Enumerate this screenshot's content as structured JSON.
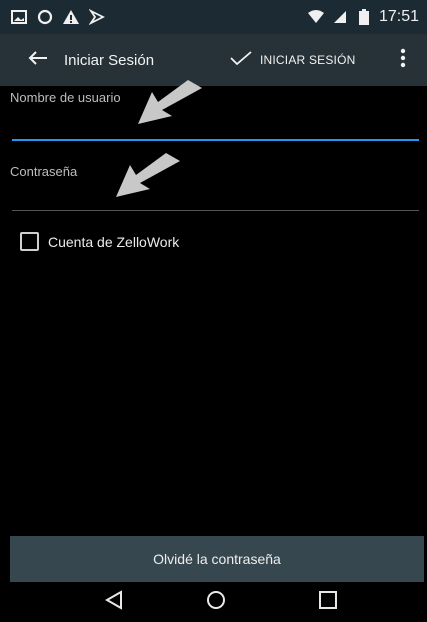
{
  "status_bar": {
    "time": "17:51",
    "left_icons": [
      "image-icon",
      "circle-icon",
      "warning-icon",
      "flag-icon"
    ],
    "right_icons": [
      "wifi-icon",
      "signal-icon",
      "battery-icon"
    ]
  },
  "app_bar": {
    "title": "Iniciar Sesión",
    "action_label": "INICIAR SESIÓN",
    "back_icon": "arrow-back-icon",
    "action_icon": "check-icon",
    "overflow_icon": "more-vert-icon"
  },
  "form": {
    "username_label": "Nombre de usuario",
    "username_value": "",
    "password_label": "Contraseña",
    "password_value": "",
    "checkbox_label": "Cuenta de ZelloWork",
    "checkbox_checked": false
  },
  "annotation_icons": [
    "pointer-arrow-icon",
    "pointer-arrow-icon"
  ],
  "forgot_button": "Olvidé la contraseña",
  "nav_bar": {
    "icons": [
      "nav-back-icon",
      "nav-home-icon",
      "nav-recents-icon"
    ]
  },
  "colors": {
    "status_bar": "#1c2b33",
    "app_bar": "#263238",
    "accent": "#2196f3",
    "background": "#000000",
    "bottom_button": "#37474f"
  }
}
